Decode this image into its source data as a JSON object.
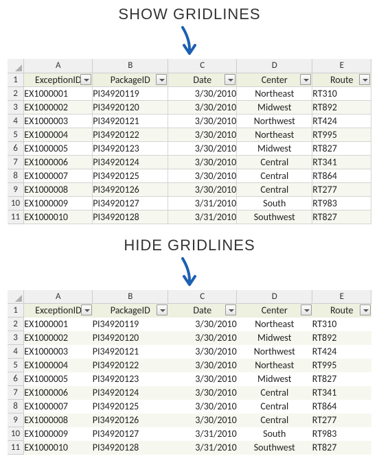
{
  "captions": {
    "show": "SHOW GRIDLINES",
    "hide": "HIDE GRIDLINES"
  },
  "columns": {
    "letters": [
      "A",
      "B",
      "C",
      "D",
      "E"
    ],
    "headers": [
      "ExceptionID",
      "PackageID",
      "Date",
      "Center",
      "Route"
    ],
    "align": [
      "left",
      "left",
      "right",
      "center",
      "left"
    ]
  },
  "rowNumbers": [
    "1",
    "2",
    "3",
    "4",
    "5",
    "6",
    "7",
    "8",
    "9",
    "10",
    "11"
  ],
  "rows": [
    [
      "EX1000001",
      "PI34920119",
      "3/30/2010",
      "Northeast",
      "RT310"
    ],
    [
      "EX1000002",
      "PI34920120",
      "3/30/2010",
      "Midwest",
      "RT892"
    ],
    [
      "EX1000003",
      "PI34920121",
      "3/30/2010",
      "Northwest",
      "RT424"
    ],
    [
      "EX1000004",
      "PI34920122",
      "3/30/2010",
      "Northeast",
      "RT995"
    ],
    [
      "EX1000005",
      "PI34920123",
      "3/30/2010",
      "Midwest",
      "RT827"
    ],
    [
      "EX1000006",
      "PI34920124",
      "3/30/2010",
      "Central",
      "RT341"
    ],
    [
      "EX1000007",
      "PI34920125",
      "3/30/2010",
      "Central",
      "RT864"
    ],
    [
      "EX1000008",
      "PI34920126",
      "3/30/2010",
      "Central",
      "RT277"
    ],
    [
      "EX1000009",
      "PI34920127",
      "3/31/2010",
      "South",
      "RT983"
    ],
    [
      "EX1000010",
      "PI34920128",
      "3/31/2010",
      "Southwest",
      "RT827"
    ]
  ],
  "colors": {
    "headerBg": "#eef0e0",
    "headerBorder": "#9aa07a",
    "arrow": "#1b5fb3"
  }
}
